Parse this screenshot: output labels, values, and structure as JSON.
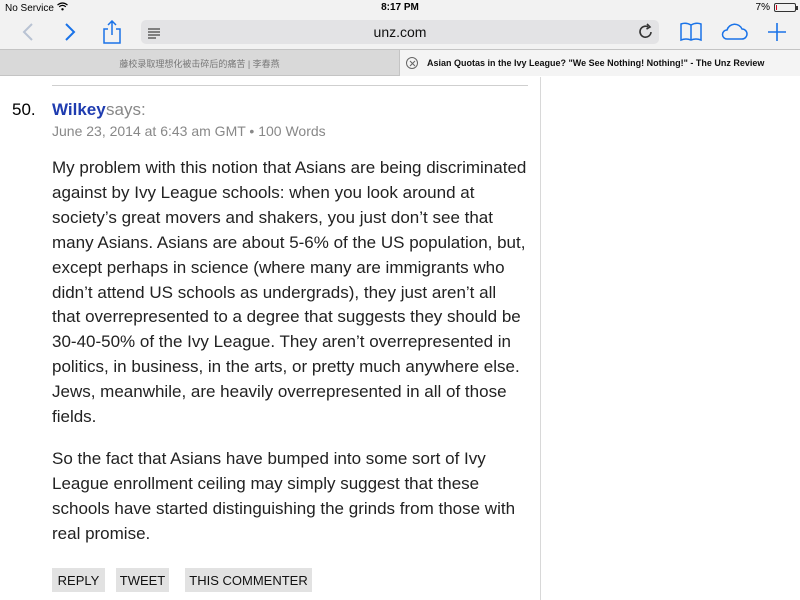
{
  "status_bar": {
    "carrier": "No Service",
    "time": "8:17 PM",
    "battery_percent": "7%",
    "battery_level": 0.07
  },
  "toolbar": {
    "url": "unz.com",
    "accent_color": "#1a73e8"
  },
  "tabs": [
    {
      "title": "藤校录取理想化被击碎后的痛苦 | 李春燕",
      "active": false
    },
    {
      "title": "Asian Quotas in the Ivy League? \"We See Nothing! Nothing!\" - The Unz Review",
      "active": true
    }
  ],
  "comment": {
    "number": "50.",
    "author": "Wilkey",
    "says": "says:",
    "meta": "June 23, 2014 at 6:43 am GMT • 100 Words",
    "paragraphs": [
      "My problem with this notion that Asians are being discriminated against by Ivy League schools: when you look around at society’s great movers and shakers, you just don’t see that many Asians. Asians are about 5-6% of the US population, but, except perhaps in science (where many are immigrants who didn’t attend US schools as undergrads), they just aren’t all that overrepresented to a degree that suggests they should be 30-40-50% of the Ivy League. They aren’t overrepresented in politics, in business, in the arts, or pretty much anywhere else. Jews, meanwhile, are heavily overrepresented in all of those fields.",
      "So the fact that Asians have bumped into some sort of Ivy League enrollment ceiling may simply suggest that these schools have started distinguishing the grinds from those with real promise."
    ],
    "buttons": {
      "reply": "REPLY",
      "tweet": "TWEET",
      "this_commenter": "THIS COMMENTER"
    }
  }
}
